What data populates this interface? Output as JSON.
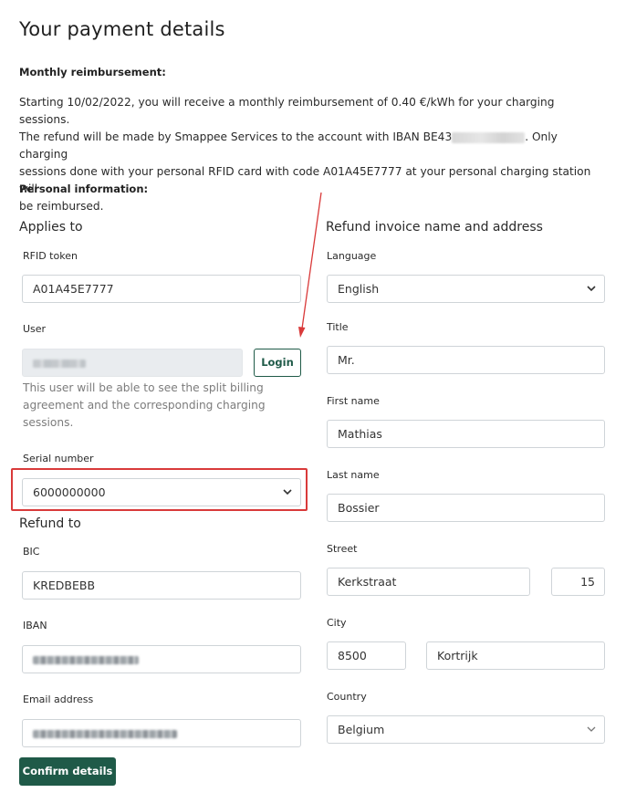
{
  "page": {
    "title": "Your payment details"
  },
  "reimbursement": {
    "heading": "Monthly reimbursement:",
    "line1": "Starting 10/02/2022, you will receive a monthly reimbursement of 0.40 €/kWh for your charging sessions.",
    "line2_before": "The refund will be made by Smappee Services to the account with IBAN BE43",
    "line2_after": ". Only charging",
    "line3": "sessions done with your personal RFID card with code A01A45E7777 at your personal charging station will",
    "line4": "be reimbursed."
  },
  "personal": {
    "heading": "Personal information:"
  },
  "applies_to": {
    "title": "Applies to",
    "rfid_label": "RFID token",
    "rfid_value": "A01A45E7777",
    "user_label": "User",
    "login_label": "Login",
    "hint_line1": "This user will be able to see the split billing",
    "hint_line2": "agreement and the corresponding charging",
    "hint_line3": "sessions.",
    "serial_label": "Serial number",
    "serial_value": "6000000000"
  },
  "refund_to": {
    "title": "Refund to",
    "bic_label": "BIC",
    "bic_value": "KREDBEBB",
    "iban_label": "IBAN",
    "email_label": "Email address"
  },
  "invoice": {
    "title": "Refund invoice name and address",
    "language_label": "Language",
    "language_value": "English",
    "title_label": "Title",
    "title_value": "Mr.",
    "first_name_label": "First name",
    "first_name_value": "Mathias",
    "last_name_label": "Last name",
    "last_name_value": "Bossier",
    "street_label": "Street",
    "street_value": "Kerkstraat",
    "number_value": "15",
    "city_label": "City",
    "postcode_value": "8500",
    "city_value": "Kortrijk",
    "country_label": "Country",
    "country_value": "Belgium"
  },
  "actions": {
    "confirm_label": "Confirm details"
  },
  "colors": {
    "primary": "#1f5a48",
    "annotation": "#d93a3a",
    "border": "#cfd4d8",
    "disabled_bg": "#e9ecef"
  }
}
